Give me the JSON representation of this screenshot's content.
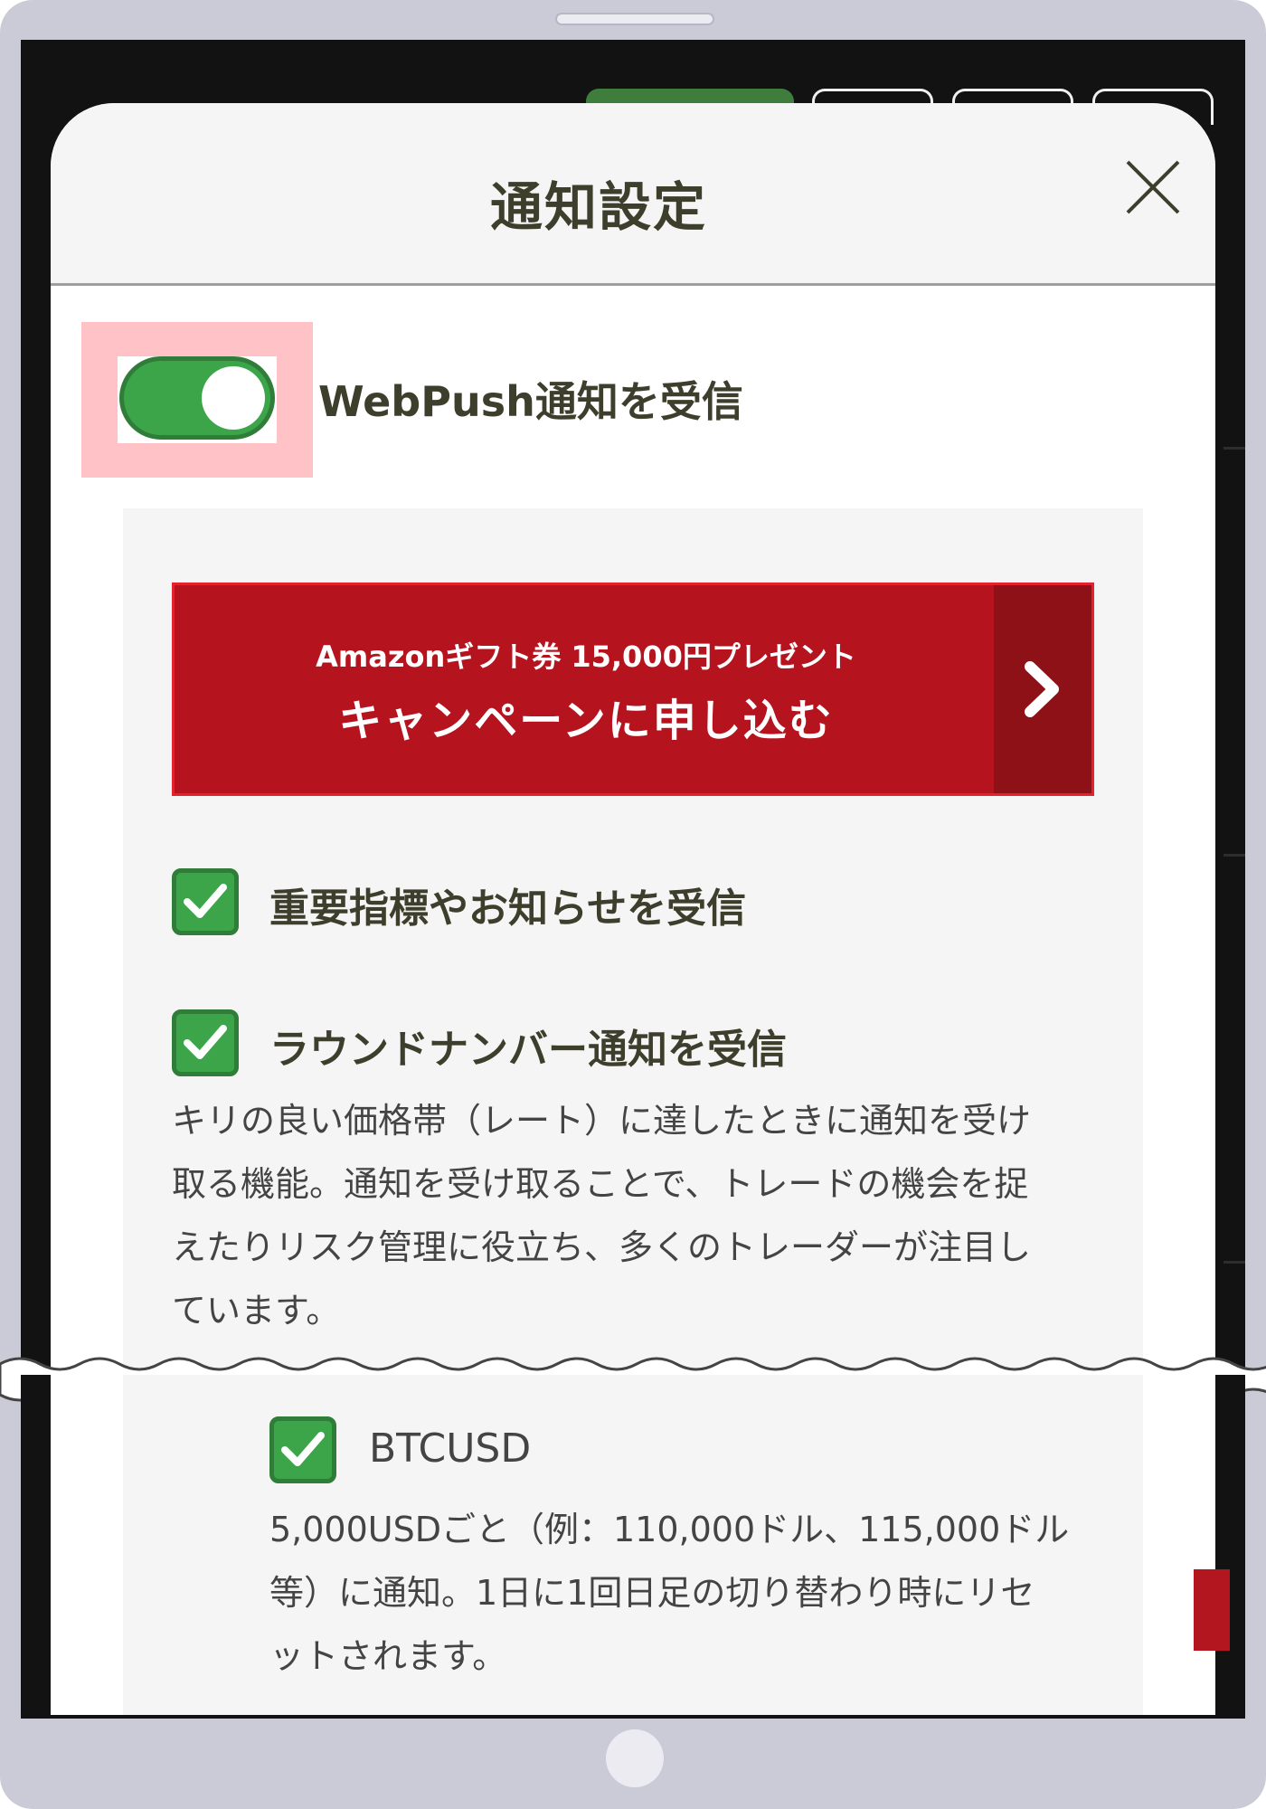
{
  "modal": {
    "title": "通知設定",
    "webpush_label": "WebPush通知を受信"
  },
  "campaign": {
    "line1": "Amazonギフト券 15,000円プレゼント",
    "line2": "キャンペーンに申し込む"
  },
  "options": [
    {
      "label": "重要指標やお知らせを受信",
      "checked": true
    },
    {
      "label": "ラウンドナンバー通知を受信",
      "checked": true,
      "description_lines": [
        "キリの良い価格帯（レート）に達したときに通知を受け",
        "取る機能。通知を受け取ることで、トレードの機会を捉",
        "えたりリスク管理に役立ち、多くのトレーダーが注目し",
        "ています。"
      ]
    }
  ],
  "sub_option": {
    "label": "BTCUSD",
    "checked": true,
    "description_lines": [
      "5,000USDごと（例：110,000ドル、115,000ドル",
      "等）に通知。1日に1回日足の切り替わり時にリセ",
      "ットされます。"
    ]
  },
  "colors": {
    "accent_green": "#3ca54a",
    "campaign_red": "#b5141f",
    "highlight_pink": "#ffc3c7",
    "title_text": "#3e3e2c"
  },
  "icons": {
    "close": "close-icon",
    "arrow": "chevron-right-icon",
    "check": "checkmark-icon"
  }
}
